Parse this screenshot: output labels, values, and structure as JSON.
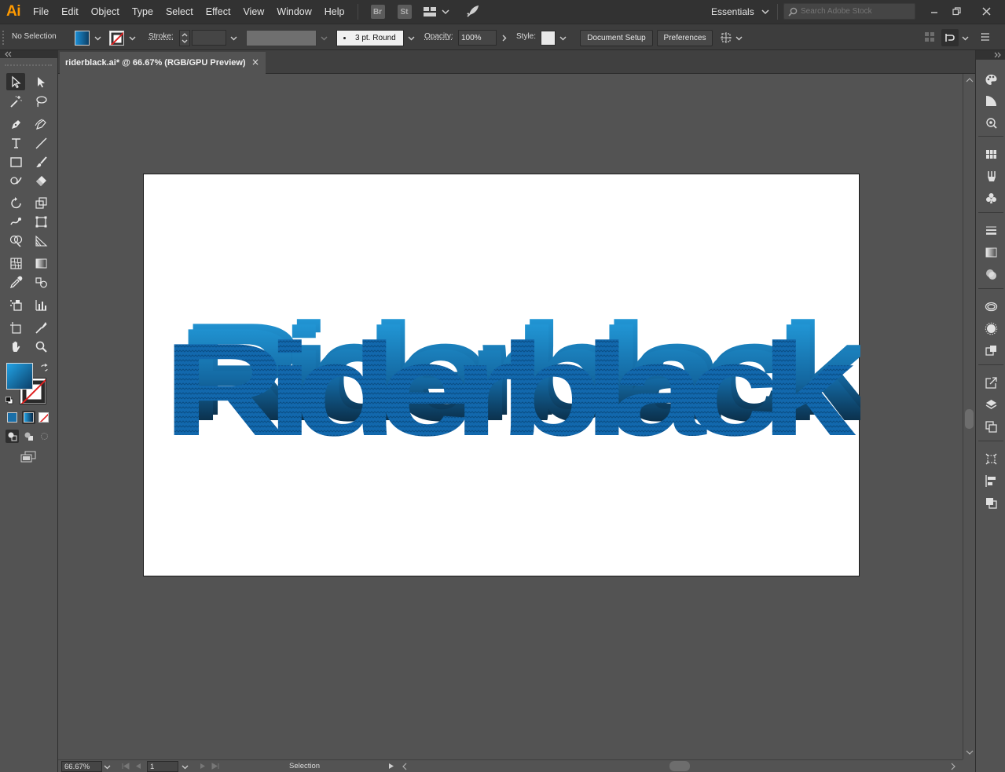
{
  "app": {
    "logo": "Ai"
  },
  "menu": [
    "File",
    "Edit",
    "Object",
    "Type",
    "Select",
    "Effect",
    "View",
    "Window",
    "Help"
  ],
  "menubar_badges": {
    "bridge": "Br",
    "stock": "St"
  },
  "workspace": {
    "label": "Essentials"
  },
  "search": {
    "placeholder": "Search Adobe Stock"
  },
  "control_bar": {
    "selection_status": "No Selection",
    "stroke_label": "Stroke:",
    "brush_label": "3 pt. Round",
    "opacity_label": "Opacity:",
    "opacity_value": "100%",
    "style_label": "Style:",
    "document_setup_label": "Document Setup",
    "preferences_label": "Preferences"
  },
  "document_tab": {
    "title": "riderblack.ai* @ 66.67% (RGB/GPU Preview)",
    "close_glyph": "×"
  },
  "artwork": {
    "text": "Riderblack"
  },
  "status_bar": {
    "zoom": "66.67%",
    "artboard_number": "1",
    "current_tool": "Selection"
  },
  "colors": {
    "accent": "#ff9a00",
    "chrome_dark": "#323232",
    "chrome_mid": "#535353",
    "fill_gradient_start": "#1b8fd6",
    "fill_gradient_end": "#0a0a0a",
    "text_blue": "#0f5f9e",
    "text_light_blue": "#1f9ee0"
  }
}
